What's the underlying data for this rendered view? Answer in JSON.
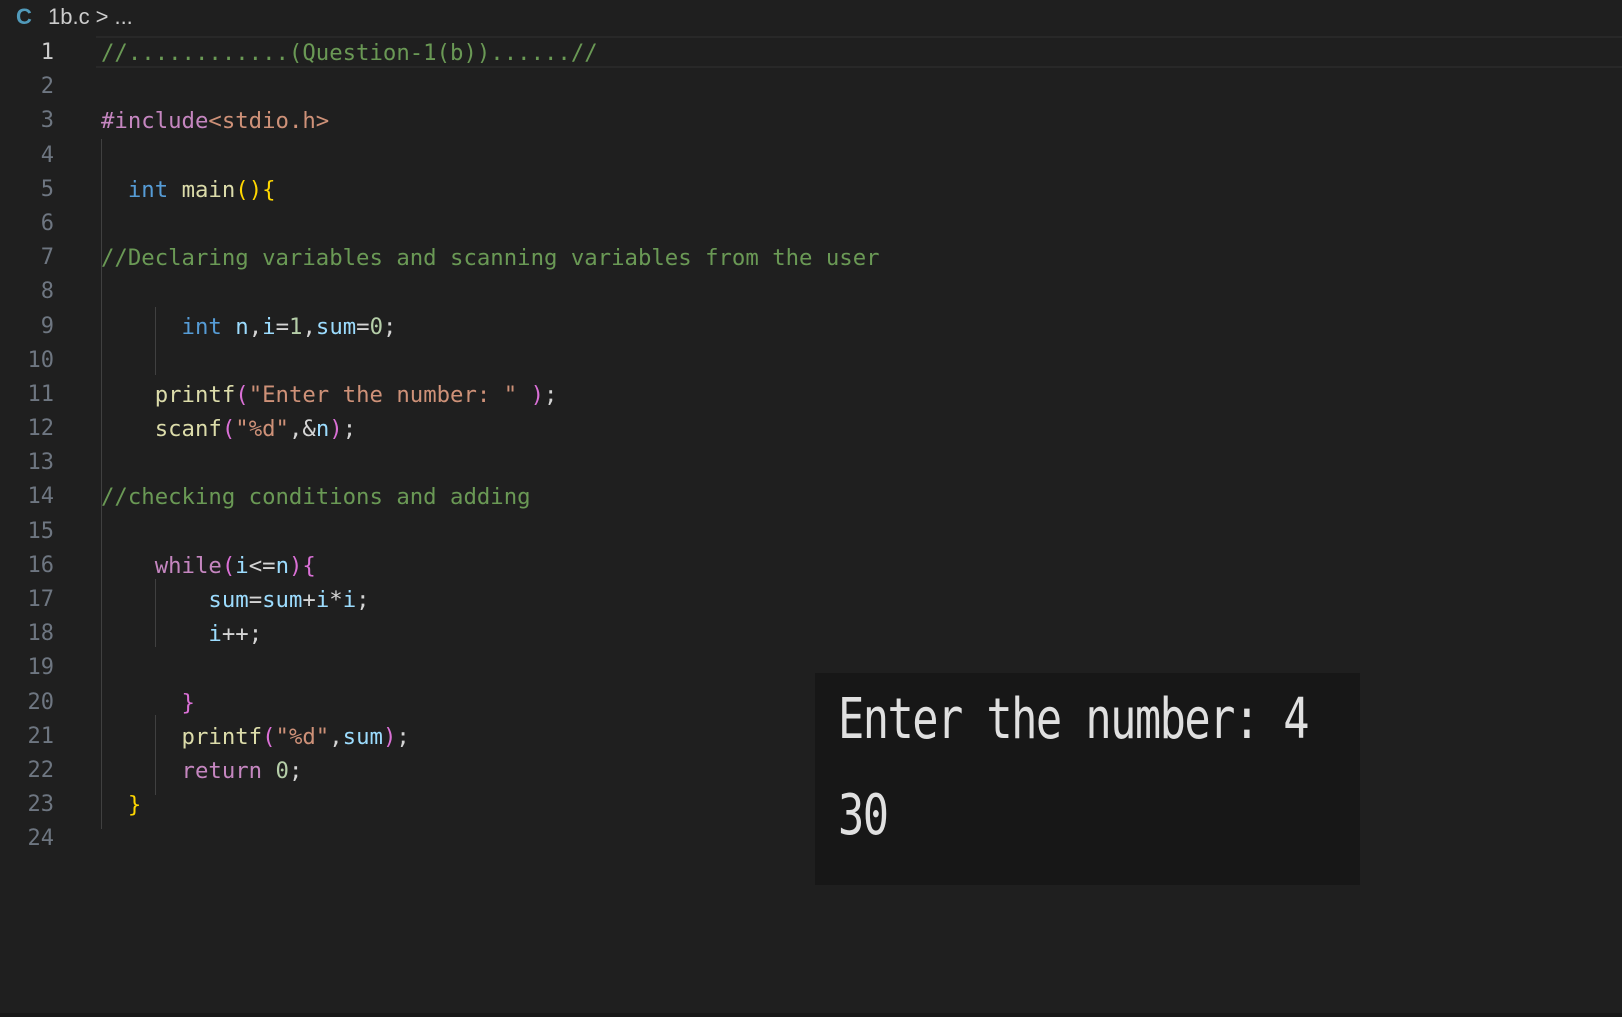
{
  "breadcrumb": {
    "icon_letter": "C",
    "file": "1b.c",
    "separator": ">",
    "more": "..."
  },
  "editor": {
    "line_numbers": [
      "1",
      "2",
      "3",
      "4",
      "5",
      "6",
      "7",
      "8",
      "9",
      "10",
      "11",
      "12",
      "13",
      "14",
      "15",
      "16",
      "17",
      "18",
      "19",
      "20",
      "21",
      "22",
      "23",
      "24"
    ],
    "active_line": "1",
    "code": {
      "l1": "//............(Question-1(b))......//",
      "l3_pp": "#include",
      "l3_inc": "<stdio.h>",
      "l5_kw": "int",
      "l5_fn": "main",
      "l7": "//Declaring variables and scanning variables from the user",
      "l9_kw": "int",
      "l9_n": "n",
      "l9_i": "i",
      "l9_one": "1",
      "l9_sum": "sum",
      "l9_zero": "0",
      "l11_fn": "printf",
      "l11_str": "\"Enter the number: \"",
      "l12_fn": "scanf",
      "l12_str": "\"%d\"",
      "l12_n": "n",
      "l14": "//checking conditions and adding",
      "l16_kw": "while",
      "l16_i": "i",
      "l16_n": "n",
      "l17_sum1": "sum",
      "l17_sum2": "sum",
      "l17_i1": "i",
      "l17_i2": "i",
      "l18_i": "i",
      "l21_fn": "printf",
      "l21_str": "\"%d\"",
      "l21_sum": "sum",
      "l22_kw": "return",
      "l22_zero": "0"
    }
  },
  "output": {
    "line1": "Enter the number: 4",
    "line2": "30"
  },
  "colors": {
    "background": "#1f1f1f",
    "comment": "#6a9955",
    "keyword": "#569cd6",
    "control": "#c586c0",
    "function": "#dcdcaa",
    "variable": "#9cdcfe",
    "number": "#b5cea8",
    "string": "#ce9178"
  }
}
